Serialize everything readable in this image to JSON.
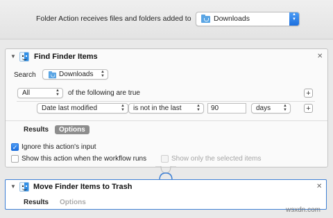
{
  "topbar": {
    "label": "Folder Action receives files and folders added to",
    "folder_popup": {
      "value": "Downloads",
      "icon": "folder-icon"
    }
  },
  "find_action": {
    "title": "Find Finder Items",
    "icon": "finder-icon",
    "search_label": "Search",
    "search_popup": {
      "value": "Downloads",
      "icon": "folder-icon"
    },
    "match_popup": "All",
    "match_text": "of the following are true",
    "criteria": {
      "attribute": "Date last modified",
      "operator": "is not in the last",
      "amount": "90",
      "unit": "days"
    },
    "tabs": {
      "results": "Results",
      "options": "Options",
      "active": "Options"
    },
    "options": {
      "ignore_input": {
        "label": "Ignore this action's input",
        "checked": true
      },
      "show_when_runs": {
        "label": "Show this action when the workflow runs",
        "checked": false
      },
      "show_selected": {
        "label": "Show only the selected items",
        "checked": false,
        "enabled": false
      }
    }
  },
  "trash_action": {
    "title": "Move Finder Items to Trash",
    "icon": "finder-icon",
    "tabs": {
      "results": "Results",
      "options": "Options"
    }
  },
  "watermark": "wsxdn.com",
  "colors": {
    "accent": "#1c6fde",
    "selection_border": "#3d7fd4",
    "active_tab": "#8d8d8d"
  }
}
